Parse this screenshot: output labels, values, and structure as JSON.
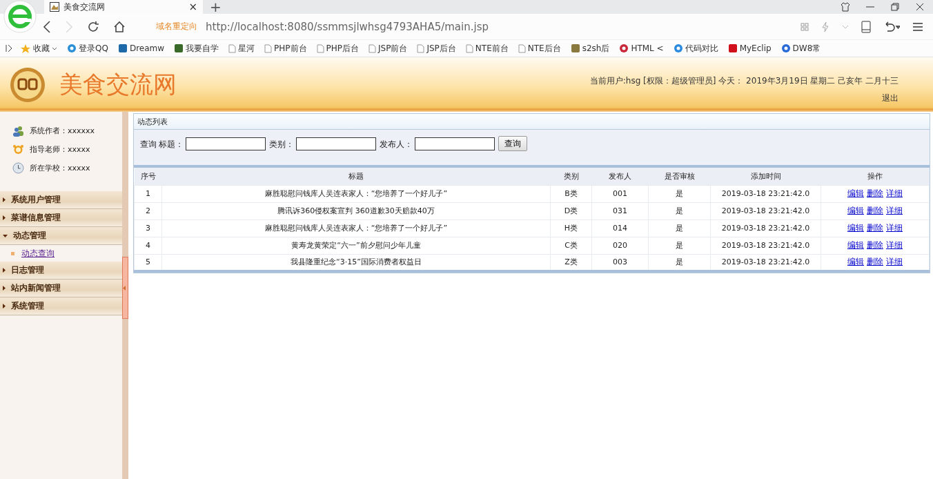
{
  "browser": {
    "tab": {
      "title": "美食交流网",
      "close": "×"
    },
    "new_tab": "+",
    "redirect_label": "域名重定向",
    "url": "http://localhost:8080/ssmmsjlwhsg4793AHA5/main.jsp",
    "bookmarks": [
      "收藏",
      "登录QQ",
      "Dreamw",
      "我要自学",
      "星河",
      "PHP前台",
      "PHP后台",
      "JSP前台",
      "JSP后台",
      "NTE前台",
      "NTE后台",
      "s2sh后",
      "HTML <",
      "代码对比",
      "MyEclip",
      "DW8常"
    ]
  },
  "header": {
    "site_title": "美食交流网",
    "user_info": "当前用户:hsg [权限：超级管理员] 今天： 2019年3月19日 星期二 己亥年 二月十三",
    "logout": "退出"
  },
  "sidebar": {
    "info": [
      "系统作者：xxxxxx",
      "指导老师：xxxxx",
      "所在学校：xxxxx"
    ],
    "menu": [
      {
        "label": "系统用户管理",
        "expanded": false
      },
      {
        "label": "菜谱信息管理",
        "expanded": false
      },
      {
        "label": "动态管理",
        "expanded": true,
        "children": [
          {
            "label": "动态查询"
          }
        ]
      },
      {
        "label": "日志管理",
        "expanded": false
      },
      {
        "label": "站内新闻管理",
        "expanded": false
      },
      {
        "label": "系统管理",
        "expanded": false
      }
    ]
  },
  "panel": {
    "title": "动态列表",
    "search": {
      "prefix": "查询",
      "fields": [
        {
          "label": "标题："
        },
        {
          "label": "类别："
        },
        {
          "label": "发布人："
        }
      ],
      "button": "查询"
    },
    "table": {
      "columns": [
        "序号",
        "标题",
        "类别",
        "发布人",
        "是否审核",
        "添加时间",
        "操作"
      ],
      "rows": [
        {
          "cells": [
            "1",
            "麻胜聪慰问钱库人吴连表家人：“您培养了一个好儿子”",
            "B类",
            "001",
            "是",
            "2019-03-18 23:21:42.0"
          ],
          "actions": [
            "编辑",
            "删除",
            "详细"
          ]
        },
        {
          "cells": [
            "2",
            "腾讯诉360侵权案宣判 360道歉30天赔款40万",
            "D类",
            "031",
            "是",
            "2019-03-18 23:21:42.0"
          ],
          "actions": [
            "编辑",
            "删除",
            "详细"
          ]
        },
        {
          "cells": [
            "3",
            "麻胜聪慰问钱库人吴连表家人：“您培养了一个好儿子”",
            "H类",
            "014",
            "是",
            "2019-03-18 23:21:42.0"
          ],
          "actions": [
            "编辑",
            "删除",
            "详细"
          ]
        },
        {
          "cells": [
            "4",
            "黄寿龙黄荣定“六一”前夕慰问少年儿童",
            "C类",
            "020",
            "是",
            "2019-03-18 23:21:42.0"
          ],
          "actions": [
            "编辑",
            "删除",
            "详细"
          ]
        },
        {
          "cells": [
            "5",
            "我县隆重纪念“3·15”国际消费者权益日",
            "Z类",
            "003",
            "是",
            "2019-03-18 23:21:42.0"
          ],
          "actions": [
            "编辑",
            "删除",
            "详细"
          ]
        }
      ]
    }
  }
}
